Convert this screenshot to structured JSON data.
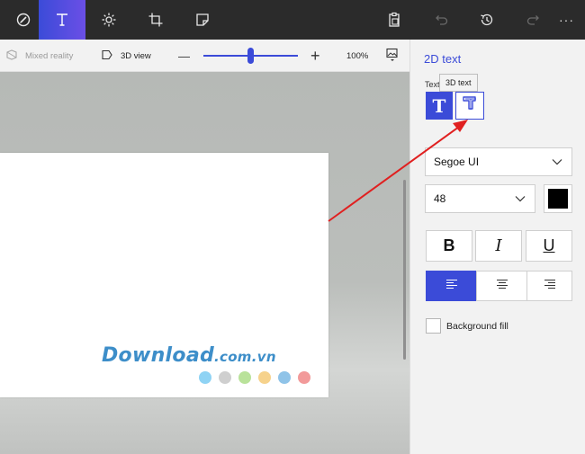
{
  "toolbar": {
    "items": [
      {
        "icon": "brushes-icon"
      },
      {
        "icon": "text-icon",
        "active": true
      },
      {
        "icon": "effects-icon"
      },
      {
        "icon": "crop-icon"
      },
      {
        "icon": "stickers-icon"
      }
    ],
    "right_items": [
      {
        "icon": "paste-icon"
      },
      {
        "icon": "undo-icon",
        "enabled": false
      },
      {
        "icon": "history-icon"
      },
      {
        "icon": "redo-icon",
        "enabled": false
      },
      {
        "icon": "more-icon",
        "glyph": "···"
      }
    ]
  },
  "subbar": {
    "mixed_reality_label": "Mixed reality",
    "view_3d_label": "3D view",
    "zoom_minus": "—",
    "zoom_plus": "+",
    "zoom_level": "100%",
    "zoom_fraction": 0.5
  },
  "canvas": {
    "watermark_brand": "Download",
    "watermark_domain": ".com.vn",
    "watermark_dots": [
      "#8fd3f4",
      "#cfcfcf",
      "#b9e29a",
      "#f6d28c",
      "#8fc3e8",
      "#f29a9a"
    ]
  },
  "panel": {
    "title": "2D text",
    "text_label": "Text",
    "tooltip": "3D text",
    "mode_2d_glyph": "T",
    "font_family": "Segoe UI",
    "font_size": "48",
    "text_color": "#000000",
    "bold_glyph": "B",
    "italic_glyph": "I",
    "underline_glyph": "U",
    "align_active": "left",
    "background_fill_label": "Background fill",
    "background_fill_checked": false
  },
  "colors": {
    "accent": "#3b4bd8",
    "arrow": "#e02020"
  }
}
